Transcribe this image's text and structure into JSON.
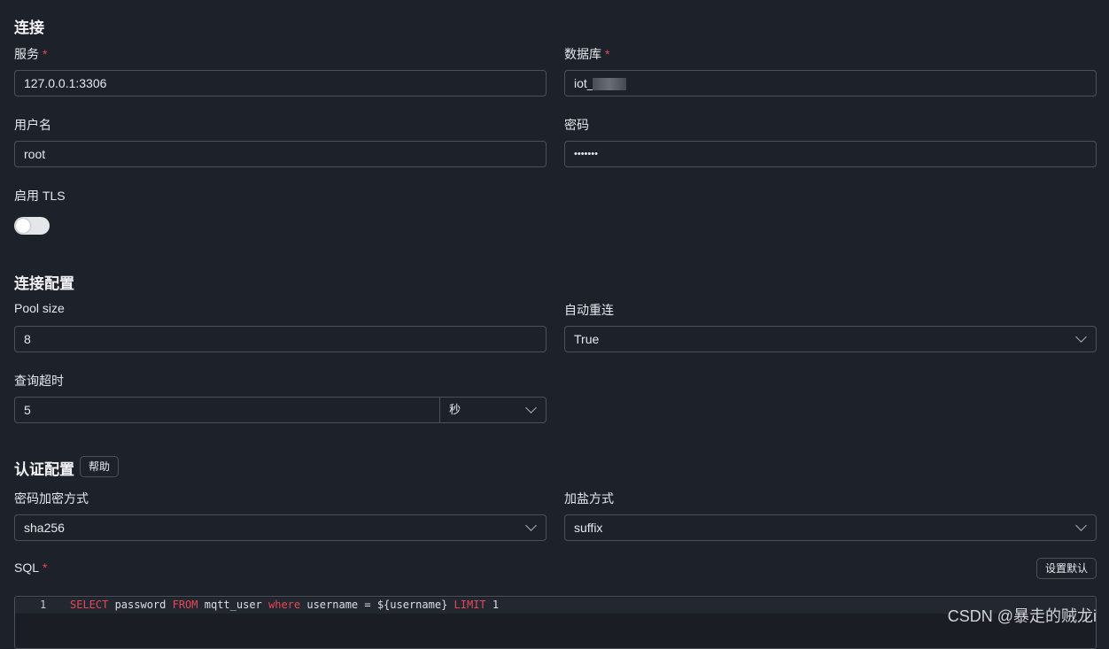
{
  "connection": {
    "title": "连接",
    "service_label": "服务",
    "service_value": "127.0.0.1:3306",
    "database_label": "数据库",
    "database_value": "iot_",
    "username_label": "用户名",
    "username_value": "root",
    "password_label": "密码",
    "password_value": "•••••••",
    "tls_label": "启用 TLS",
    "tls_enabled": false
  },
  "connection_config": {
    "title": "连接配置",
    "pool_size_label": "Pool size",
    "pool_size_value": "8",
    "auto_reconnect_label": "自动重连",
    "auto_reconnect_value": "True",
    "query_timeout_label": "查询超时",
    "query_timeout_value": "5",
    "query_timeout_unit": "秒"
  },
  "auth_config": {
    "title": "认证配置",
    "help_label": "帮助",
    "hash_label": "密码加密方式",
    "hash_value": "sha256",
    "salt_label": "加盐方式",
    "salt_value": "suffix",
    "sql_label": "SQL",
    "set_default_label": "设置默认",
    "required_mark": "*"
  },
  "sql_editor": {
    "line_number": "1",
    "tokens": {
      "select": "SELECT",
      "t1": " password ",
      "from": "FROM",
      "t2": " mqtt_user ",
      "where": "where",
      "t3": " username = ${username} ",
      "limit": "LIMIT",
      "t4": " 1"
    }
  },
  "watermark": "CSDN @暴走的贼龙i"
}
